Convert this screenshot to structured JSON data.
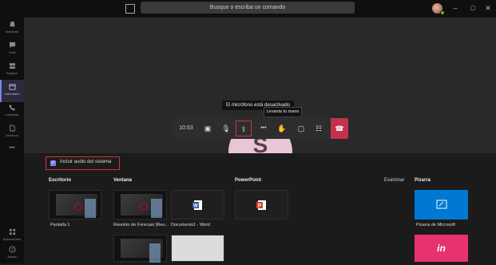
{
  "titlebar": {
    "search_placeholder": "Busque o escriba un comando",
    "compose_icon": "compose-icon",
    "minimize": "–",
    "maximize": "□",
    "close": "✕"
  },
  "rail": {
    "items": [
      {
        "label": "Actividad",
        "icon": "bell-icon"
      },
      {
        "label": "Chat",
        "icon": "chat-icon"
      },
      {
        "label": "Equipos",
        "icon": "teams-icon"
      },
      {
        "label": "Calendario",
        "icon": "calendar-icon",
        "active": true
      },
      {
        "label": "Llamadas",
        "icon": "phone-icon"
      },
      {
        "label": "Archivos",
        "icon": "files-icon"
      },
      {
        "label": "•••",
        "icon": "more-icon"
      }
    ],
    "bottom": [
      {
        "label": "Aplicaciones",
        "icon": "apps-icon"
      },
      {
        "label": "Ayuda",
        "icon": "help-icon"
      }
    ]
  },
  "stage": {
    "avatar_initial": "S",
    "mic_banner": "El micrófono está desactivado",
    "tooltip": "Levanta tu mano"
  },
  "controls": {
    "timer": "10:53",
    "camera": "▣",
    "mic": "🎙",
    "share": "⇪",
    "more": "•••",
    "hand": "✋",
    "chat": "▢",
    "people": "☷",
    "hangup": "☎"
  },
  "tray": {
    "system_audio_label": "Incluir audio del sistema",
    "sections": {
      "desktop": "Escritorio",
      "window": "Ventana",
      "powerpoint": "PowerPoint",
      "browse": "Examinar",
      "whiteboard": "Pizarra"
    },
    "desktop_items": [
      {
        "label": "Pantalla 1"
      }
    ],
    "window_items": [
      {
        "label": "Reunión de Forecast (Reu..."
      },
      {
        "label": "Documento1 - Word"
      }
    ],
    "whiteboard_items": [
      {
        "label": "Pizarra de Microsoft"
      },
      {
        "label": "in"
      }
    ]
  },
  "colors": {
    "accent": "#7b83eb",
    "highlight_box": "#d13438",
    "hangup": "#c4314b",
    "word": "#2b579a",
    "powerpoint": "#d24726",
    "whiteboard": "#0078d4",
    "invision": "#e7336d"
  }
}
